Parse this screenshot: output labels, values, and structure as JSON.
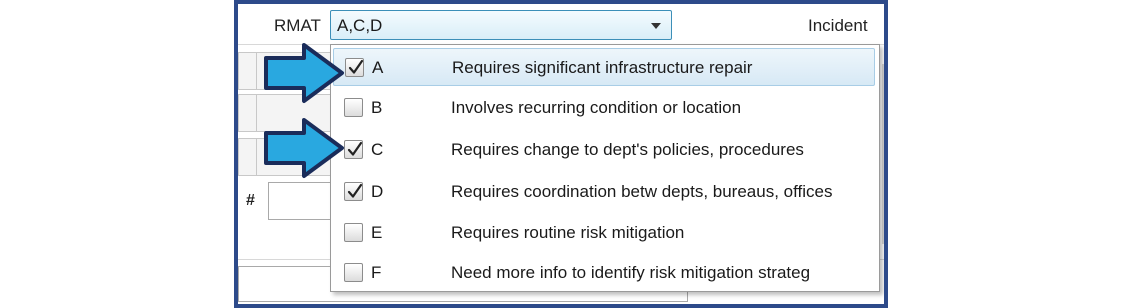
{
  "rmat": {
    "label": "RMAT",
    "value": "A,C,D"
  },
  "incident_label": "Incident",
  "hash_label": "#",
  "options": [
    {
      "code": "A",
      "description": "Requires significant infrastructure repair",
      "checked": true,
      "highlighted": true
    },
    {
      "code": "B",
      "description": "Involves recurring condition or location",
      "checked": false,
      "highlighted": false
    },
    {
      "code": "C",
      "description": "Requires change to dept's policies, procedures",
      "checked": true,
      "highlighted": false
    },
    {
      "code": "D",
      "description": "Requires coordination betw depts, bureaus, offices",
      "checked": true,
      "highlighted": false
    },
    {
      "code": "E",
      "description": "Requires routine risk mitigation",
      "checked": false,
      "highlighted": false
    },
    {
      "code": "F",
      "description": "Need more info to identify risk mitigation strateg",
      "checked": false,
      "highlighted": false
    }
  ],
  "colors": {
    "frame_border": "#2d4a8a",
    "combo_border": "#3c8fb8",
    "arrow_fill": "#29a8e0",
    "arrow_stroke": "#1a2c5a"
  },
  "icons": {
    "dropdown": "chevron-down-icon",
    "checkmark": "checkmark-icon",
    "pointer": "arrow-right-icon"
  }
}
